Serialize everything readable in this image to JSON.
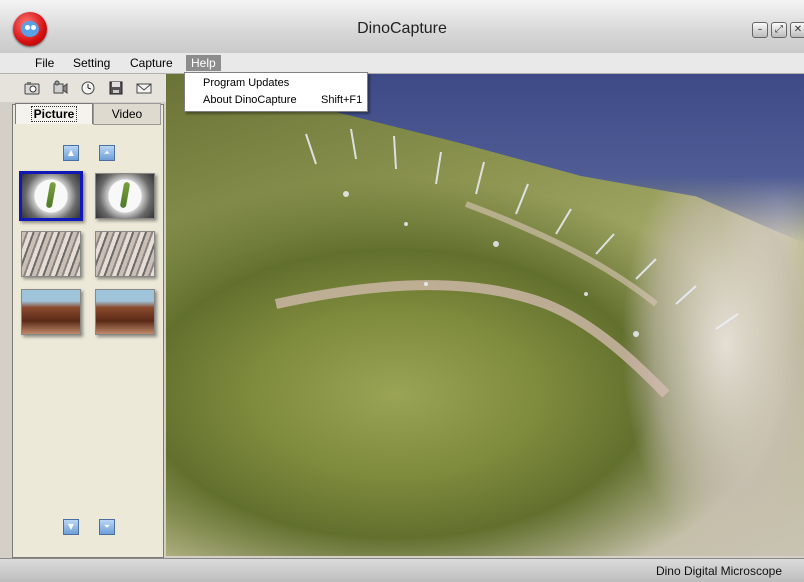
{
  "window": {
    "title": "DinoCapture",
    "controls": [
      "minimize",
      "maximize",
      "close"
    ]
  },
  "menu": {
    "items": [
      "File",
      "Setting",
      "Capture",
      "Help"
    ],
    "active": "Help"
  },
  "help_menu": {
    "items": [
      {
        "label": "Program Updates",
        "shortcut": ""
      },
      {
        "label": "About DinoCapture",
        "shortcut": "Shift+F1"
      }
    ]
  },
  "toolbar": {
    "icons": [
      "camera-icon",
      "video-camera-icon",
      "timer-icon",
      "save-icon",
      "email-icon"
    ]
  },
  "side_panel": {
    "tabs": [
      "Picture",
      "Video"
    ],
    "active_tab": "Picture",
    "thumbnails": [
      {
        "name": "plate-with-sprout",
        "selected": true
      },
      {
        "name": "plate-with-sprout",
        "selected": false
      },
      {
        "name": "straw-fibers",
        "selected": false
      },
      {
        "name": "straw-fibers",
        "selected": false
      },
      {
        "name": "rusty-surface",
        "selected": false
      },
      {
        "name": "rusty-surface",
        "selected": false
      }
    ]
  },
  "status_bar": {
    "text": "Dino Digital Microscope"
  }
}
